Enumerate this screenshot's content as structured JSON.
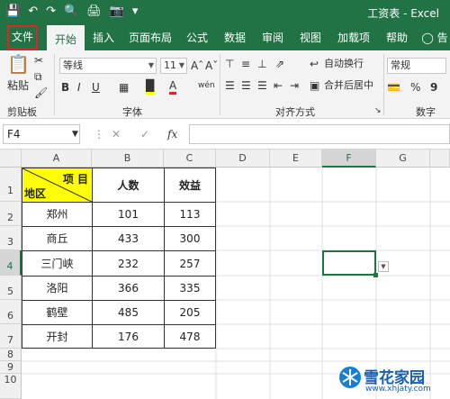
{
  "title": "工资表 - Excel",
  "tabs": [
    "文件",
    "开始",
    "插入",
    "页面布局",
    "公式",
    "数据",
    "审阅",
    "视图",
    "加载项",
    "帮助"
  ],
  "tell_icon": "lightbulb-icon",
  "tell_text": "告",
  "ribbon": {
    "paste": "粘贴",
    "clipboard": "剪贴板",
    "font_name": "等线",
    "font_size": "11",
    "font_group": "字体",
    "wrap": "自动换行",
    "merge": "合并后居中",
    "align_group": "对齐方式",
    "num_format": "常规",
    "num_group": "数字",
    "bold": "B",
    "italic": "I",
    "underline": "U",
    "percent": "%",
    "comma": "9"
  },
  "namebox": "F4",
  "fx": "fx",
  "columns": [
    "A",
    "B",
    "C",
    "D",
    "E",
    "F",
    "G"
  ],
  "rows": [
    "1",
    "2",
    "3",
    "4",
    "5",
    "6",
    "7",
    "8",
    "9",
    "10"
  ],
  "header": {
    "a1_top": "项 目",
    "a1_bottom": "地区",
    "b1": "人数",
    "c1": "效益"
  },
  "data": [
    [
      "郑州",
      "101",
      "113"
    ],
    [
      "商丘",
      "433",
      "300"
    ],
    [
      "三门峡",
      "232",
      "257"
    ],
    [
      "洛阳",
      "366",
      "335"
    ],
    [
      "鹤壁",
      "485",
      "205"
    ],
    [
      "开封",
      "176",
      "478"
    ]
  ],
  "watermark": {
    "name": "雪花家园",
    "url": "www.xhjaty.com"
  },
  "colors": {
    "excel_green": "#217346",
    "highlight_yellow": "#ffff00",
    "file_border": "#e0242a"
  }
}
